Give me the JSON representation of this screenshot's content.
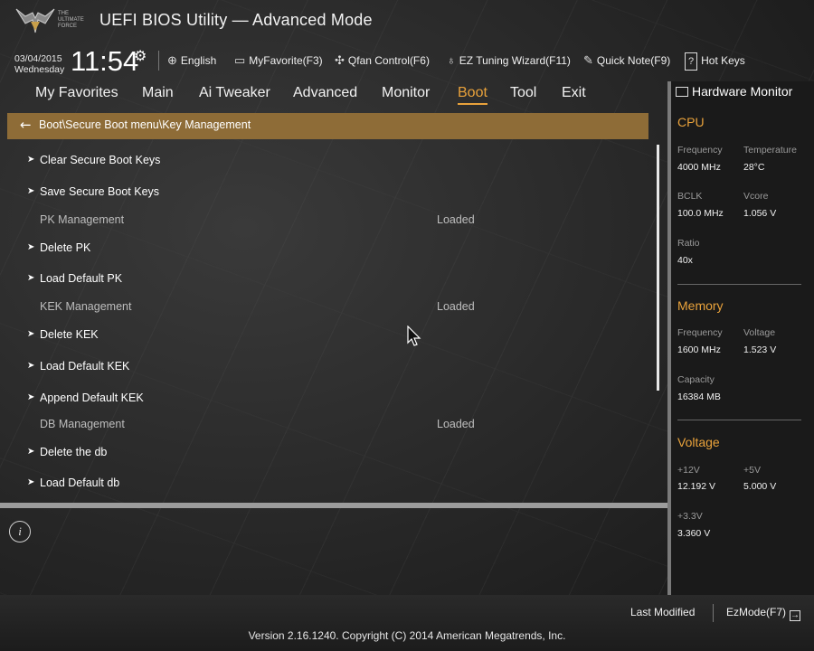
{
  "header": {
    "logo_text": "THE ULTIMATE FORCE",
    "title": "UEFI BIOS Utility — Advanced Mode",
    "date": "03/04/2015",
    "weekday": "Wednesday",
    "time": "11:54",
    "items": [
      {
        "label": "English",
        "icon": "globe-icon"
      },
      {
        "label": "MyFavorite(F3)",
        "icon": "favorite-icon"
      },
      {
        "label": "Qfan Control(F6)",
        "icon": "fan-icon"
      },
      {
        "label": "EZ Tuning Wizard(F11)",
        "icon": "bulb-icon"
      },
      {
        "label": "Quick Note(F9)",
        "icon": "note-icon"
      },
      {
        "label": "Hot Keys",
        "icon": "help-icon"
      }
    ]
  },
  "tabs": [
    "My Favorites",
    "Main",
    "Ai Tweaker",
    "Advanced",
    "Monitor",
    "Boot",
    "Tool",
    "Exit"
  ],
  "active_tab": "Boot",
  "breadcrumb": "Boot\\Secure Boot menu\\Key Management",
  "rows": [
    {
      "type": "link",
      "label": "Clear Secure Boot Keys"
    },
    {
      "type": "link",
      "label": "Save Secure Boot Keys"
    },
    {
      "type": "sub",
      "label": "PK Management",
      "value": "Loaded"
    },
    {
      "type": "link",
      "label": "Delete PK"
    },
    {
      "type": "link",
      "label": "Load Default PK"
    },
    {
      "type": "sub",
      "label": "KEK Management",
      "value": "Loaded"
    },
    {
      "type": "link",
      "label": "Delete KEK"
    },
    {
      "type": "link",
      "label": "Load Default KEK"
    },
    {
      "type": "link",
      "label": "Append Default KEK"
    },
    {
      "type": "sub",
      "label": "DB Management",
      "value": "Loaded"
    },
    {
      "type": "link",
      "label": "Delete the db"
    },
    {
      "type": "link",
      "label": "Load Default db"
    }
  ],
  "hardware_monitor": {
    "title": "Hardware Monitor",
    "cpu": {
      "heading": "CPU",
      "frequency_label": "Frequency",
      "frequency": "4000 MHz",
      "temperature_label": "Temperature",
      "temperature": "28°C",
      "bclk_label": "BCLK",
      "bclk": "100.0 MHz",
      "vcore_label": "Vcore",
      "vcore": "1.056 V",
      "ratio_label": "Ratio",
      "ratio": "40x"
    },
    "memory": {
      "heading": "Memory",
      "frequency_label": "Frequency",
      "frequency": "1600 MHz",
      "voltage_label": "Voltage",
      "voltage": "1.523 V",
      "capacity_label": "Capacity",
      "capacity": "16384 MB"
    },
    "voltage": {
      "heading": "Voltage",
      "v12_label": "+12V",
      "v12": "12.192 V",
      "v5_label": "+5V",
      "v5": "5.000 V",
      "v33_label": "+3.3V",
      "v33": "3.360 V"
    }
  },
  "footer": {
    "last_modified": "Last Modified",
    "ezmode": "EzMode(F7)",
    "version": "Version 2.16.1240. Copyright (C) 2014 American Megatrends, Inc."
  },
  "colors": {
    "accent": "#e9a23b",
    "breadcrumb_bg": "#8e6c37"
  }
}
